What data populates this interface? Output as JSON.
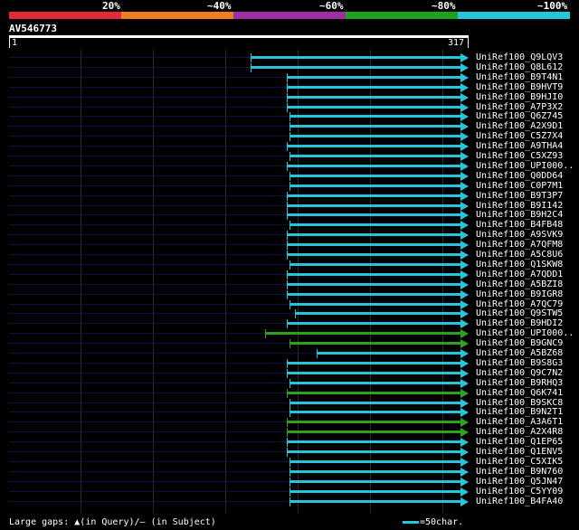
{
  "header": {
    "percent_labels": [
      "20%",
      "~40%",
      "~60%",
      "~80%",
      "~100%"
    ],
    "band_colors": [
      "#e6283a",
      "#ef7f1c",
      "#9f2ea3",
      "#1ea31e",
      "#26c6da"
    ]
  },
  "query": {
    "id": "AV546773",
    "start": "1",
    "end": "317"
  },
  "colors": {
    "cyan": "#26c6da",
    "green": "#2ea21e",
    "hit_line": "#101040",
    "grid": "#2a2a2a"
  },
  "hits": [
    {
      "name": "UniRef100_Q9LQV3",
      "start": 0.525,
      "color": "cyan"
    },
    {
      "name": "UniRef100_Q8L612",
      "start": 0.525,
      "color": "cyan"
    },
    {
      "name": "UniRef100_B9T4N1",
      "start": 0.605,
      "color": "cyan"
    },
    {
      "name": "UniRef100_B9HVT9",
      "start": 0.605,
      "color": "cyan"
    },
    {
      "name": "UniRef100_B9HJI0",
      "start": 0.605,
      "color": "cyan"
    },
    {
      "name": "UniRef100_A7P3X2",
      "start": 0.605,
      "color": "cyan"
    },
    {
      "name": "UniRef100_Q6Z745",
      "start": 0.61,
      "color": "cyan"
    },
    {
      "name": "UniRef100_A2X9D1",
      "start": 0.61,
      "color": "cyan"
    },
    {
      "name": "UniRef100_C5Z7X4",
      "start": 0.61,
      "color": "cyan"
    },
    {
      "name": "UniRef100_A9THA4",
      "start": 0.605,
      "color": "cyan"
    },
    {
      "name": "UniRef100_C5XZ93",
      "start": 0.61,
      "color": "cyan"
    },
    {
      "name": "UniRef100_UPI000..",
      "start": 0.605,
      "color": "cyan"
    },
    {
      "name": "UniRef100_Q0DD64",
      "start": 0.61,
      "color": "cyan"
    },
    {
      "name": "UniRef100_C0P7M1",
      "start": 0.61,
      "color": "cyan"
    },
    {
      "name": "UniRef100_B9T3P7",
      "start": 0.605,
      "color": "cyan"
    },
    {
      "name": "UniRef100_B9I142",
      "start": 0.605,
      "color": "cyan"
    },
    {
      "name": "UniRef100_B9H2C4",
      "start": 0.605,
      "color": "cyan"
    },
    {
      "name": "UniRef100_B4FB48",
      "start": 0.61,
      "color": "cyan"
    },
    {
      "name": "UniRef100_A9SVK9",
      "start": 0.605,
      "color": "cyan"
    },
    {
      "name": "UniRef100_A7QFM8",
      "start": 0.605,
      "color": "cyan"
    },
    {
      "name": "UniRef100_A5C8U6",
      "start": 0.605,
      "color": "cyan"
    },
    {
      "name": "UniRef100_Q1SKW8",
      "start": 0.61,
      "color": "cyan"
    },
    {
      "name": "UniRef100_A7QDD1",
      "start": 0.605,
      "color": "cyan"
    },
    {
      "name": "UniRef100_A5BZI8",
      "start": 0.605,
      "color": "cyan"
    },
    {
      "name": "UniRef100_B9IGR8",
      "start": 0.605,
      "color": "cyan"
    },
    {
      "name": "UniRef100_A7QC79",
      "start": 0.61,
      "color": "cyan"
    },
    {
      "name": "UniRef100_Q9STW5",
      "start": 0.622,
      "color": "cyan"
    },
    {
      "name": "UniRef100_B9HDI2",
      "start": 0.605,
      "color": "cyan"
    },
    {
      "name": "UniRef100_UPI000..",
      "start": 0.557,
      "color": "green"
    },
    {
      "name": "UniRef100_B9GNC9",
      "start": 0.61,
      "color": "green"
    },
    {
      "name": "UniRef100_A5BZ68",
      "start": 0.67,
      "color": "cyan"
    },
    {
      "name": "UniRef100_B9S8G3",
      "start": 0.605,
      "color": "cyan"
    },
    {
      "name": "UniRef100_Q9C7N2",
      "start": 0.605,
      "color": "cyan"
    },
    {
      "name": "UniRef100_B9RHQ3",
      "start": 0.61,
      "color": "cyan"
    },
    {
      "name": "UniRef100_Q6K741",
      "start": 0.605,
      "color": "green"
    },
    {
      "name": "UniRef100_B9SKC8",
      "start": 0.61,
      "color": "cyan"
    },
    {
      "name": "UniRef100_B9N2T1",
      "start": 0.61,
      "color": "cyan"
    },
    {
      "name": "UniRef100_A3A6T1",
      "start": 0.605,
      "color": "green"
    },
    {
      "name": "UniRef100_A2X4R8",
      "start": 0.605,
      "color": "green"
    },
    {
      "name": "UniRef100_Q1EP65",
      "start": 0.605,
      "color": "cyan"
    },
    {
      "name": "UniRef100_Q1ENV5",
      "start": 0.605,
      "color": "cyan"
    },
    {
      "name": "UniRef100_C5XIK5",
      "start": 0.61,
      "color": "cyan"
    },
    {
      "name": "UniRef100_B9N760",
      "start": 0.61,
      "color": "cyan"
    },
    {
      "name": "UniRef100_Q5JN47",
      "start": 0.61,
      "color": "cyan"
    },
    {
      "name": "UniRef100_C5YY09",
      "start": 0.61,
      "color": "cyan"
    },
    {
      "name": "UniRef100_B4FA40",
      "start": 0.61,
      "color": "cyan"
    }
  ],
  "legend": {
    "gaps_label": "Large gaps:",
    "gaps_query_icon": "▲",
    "gaps_query": "(in Query)/",
    "gaps_subject": "— (in Subject)",
    "scale_label": "=50char."
  }
}
